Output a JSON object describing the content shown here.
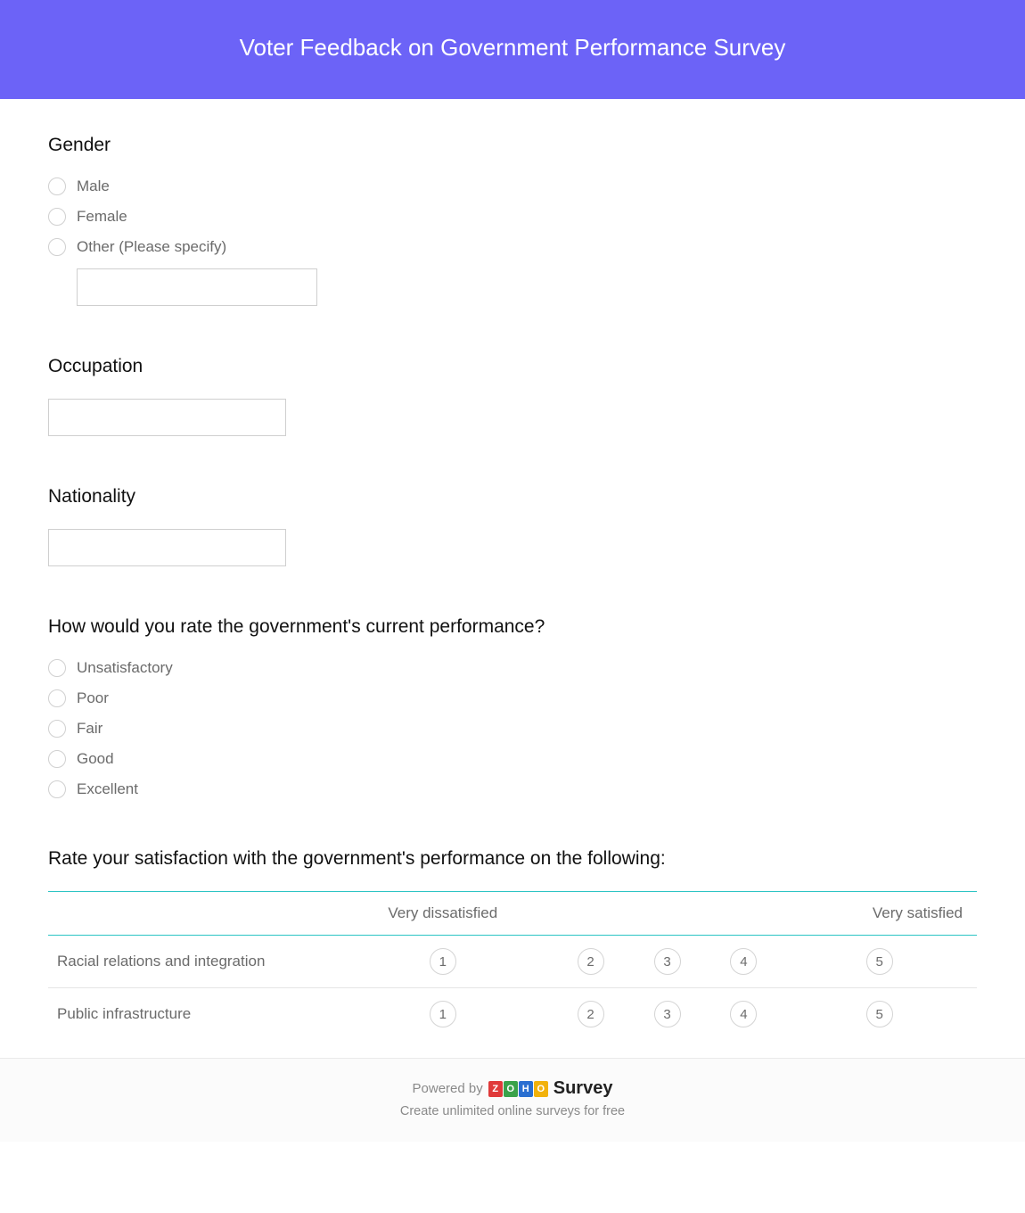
{
  "header": {
    "title": "Voter Feedback on Government Performance Survey"
  },
  "q_gender": {
    "title": "Gender",
    "options": [
      "Male",
      "Female",
      "Other (Please specify)"
    ],
    "specify_value": ""
  },
  "q_occupation": {
    "title": "Occupation",
    "value": ""
  },
  "q_nationality": {
    "title": "Nationality",
    "value": ""
  },
  "q_rating": {
    "title": "How would you rate the government's current performance?",
    "options": [
      "Unsatisfactory",
      "Poor",
      "Fair",
      "Good",
      "Excellent"
    ]
  },
  "q_matrix": {
    "title": "Rate your satisfaction with the government's performance on the following:",
    "scale_low": "Very dissatisfied",
    "scale_high": "Very satisfied",
    "scale_values": [
      "1",
      "2",
      "3",
      "4",
      "5"
    ],
    "rows": [
      "Racial relations and integration",
      "Public infrastructure"
    ]
  },
  "footer": {
    "powered_by": "Powered by",
    "brand_letters": [
      "Z",
      "O",
      "H",
      "O"
    ],
    "brand_suffix": "Survey",
    "tagline": "Create unlimited online surveys for free"
  }
}
